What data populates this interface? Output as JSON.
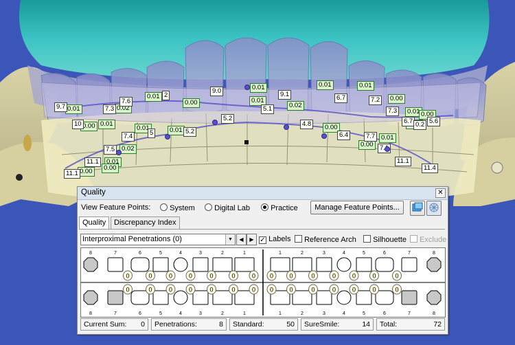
{
  "scan_labels": {
    "green": [
      "0.01",
      "0.02",
      "0.01",
      "0.01",
      "0.01",
      "0.00",
      "0.00",
      "0.01",
      "0.01",
      "0.01",
      "0.00",
      "0.02",
      "0.01",
      "0.00",
      "0.02",
      "0.00",
      "0.01",
      "0.00",
      "0.01",
      "0.00",
      "0.00",
      "0.01",
      "0.01",
      "0.00"
    ],
    "white": [
      "9.7",
      "7.3",
      "7.6",
      "2",
      "9.0",
      "9.1",
      "6.7",
      "7.2",
      "7.3",
      "6.7",
      "5.6",
      "10",
      "5.1",
      "5.2",
      "4.8",
      "7.4",
      "5",
      "5.2",
      "6.4",
      "7.7",
      "7.5",
      "11.1",
      "7.1",
      "11.1",
      "11.4",
      "11.1",
      "0.2"
    ]
  },
  "dialog": {
    "title": "Quality",
    "close_label": "✕",
    "view_feature_points_label": "View Feature Points:",
    "radio_system": "System",
    "radio_digital_lab": "Digital Lab",
    "radio_practice": "Practice",
    "selected_radio": "Practice",
    "manage_button": "Manage Feature Points...",
    "tabs": [
      "Quality",
      "Discrepancy Index"
    ],
    "active_tab": "Quality",
    "dropdown_value": "Interproximal Penetrations (0)",
    "checkboxes": {
      "labels": {
        "label": "Labels",
        "checked": true
      },
      "reference_arch": {
        "label": "Reference Arch",
        "checked": false
      },
      "silhouette": {
        "label": "Silhouette",
        "checked": false
      },
      "exclude": {
        "label": "Exclude",
        "checked": false,
        "disabled": true
      }
    },
    "chart": {
      "upper_tooth_numbers": [
        "8",
        "7",
        "6",
        "5",
        "4",
        "3",
        "2",
        "1",
        "1",
        "2",
        "3",
        "4",
        "5",
        "6",
        "7",
        "8"
      ],
      "lower_tooth_numbers": [
        "8",
        "7",
        "6",
        "5",
        "4",
        "3",
        "2",
        "1",
        "1",
        "2",
        "3",
        "4",
        "5",
        "6",
        "7",
        "8"
      ],
      "upper_contacts": [
        "0",
        "0",
        "0",
        "0",
        "0",
        "0",
        "0",
        "0",
        "0",
        "0",
        "0",
        "0",
        "0",
        "0"
      ],
      "lower_contacts": [
        "0",
        "0",
        "0",
        "0",
        "0",
        "0",
        "0",
        "0",
        "0",
        "0",
        "0",
        "0",
        "0",
        "0"
      ]
    },
    "status": {
      "current_sum_label": "Current Sum:",
      "current_sum": "0",
      "penetrations_label": "Penetrations:",
      "penetrations": "8",
      "standard_label": "Standard:",
      "standard": "50",
      "suresmile_label": "SureSmile:",
      "suresmile": "14",
      "total_label": "Total:",
      "total": "72"
    }
  }
}
